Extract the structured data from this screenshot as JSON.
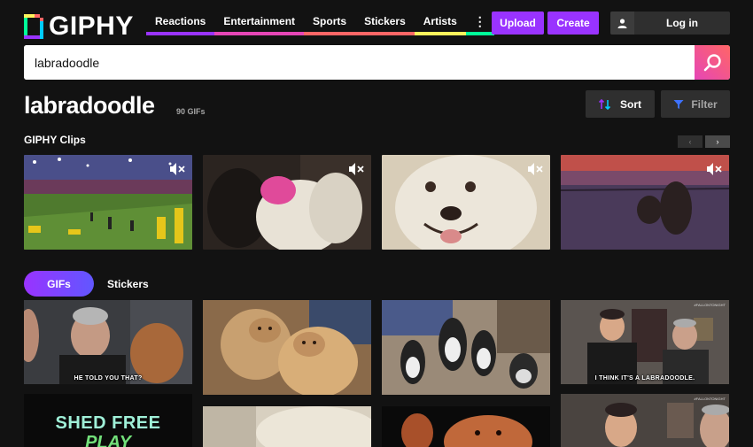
{
  "header": {
    "logo_text": "GIPHY",
    "nav": [
      {
        "label": "Reactions",
        "color": "#9933ff"
      },
      {
        "label": "Entertainment",
        "color": "#e646b6"
      },
      {
        "label": "Sports",
        "color": "#ff6666"
      },
      {
        "label": "Stickers",
        "color": "#ff6666"
      },
      {
        "label": "Artists",
        "color": "#fff35c"
      },
      {
        "label": "⋮",
        "color": "#00ff99"
      }
    ],
    "upload_label": "Upload",
    "create_label": "Create",
    "login_label": "Log in"
  },
  "search": {
    "value": "labradoodle",
    "icon": "search-icon"
  },
  "results": {
    "title": "labradoodle",
    "count": "90 GIFs",
    "sort_label": "Sort",
    "filter_label": "Filter"
  },
  "clips": {
    "section_title": "GIPHY Clips",
    "prev": "‹",
    "next": "›",
    "items": [
      {
        "icon": "mute-icon"
      },
      {
        "icon": "mute-icon"
      },
      {
        "icon": "mute-icon"
      },
      {
        "icon": "mute-icon"
      }
    ]
  },
  "tabs": {
    "gifs_label": "GIFs",
    "stickers_label": "Stickers"
  },
  "gifs": {
    "captions": [
      "HE TOLD YOU THAT?",
      "I THINK IT'S A LABRADOODLE."
    ],
    "promo_line1": "SHED FREE",
    "promo_line2": "PLAY",
    "watermark": "#FALLONTONIGHT"
  },
  "colors": {
    "accent": "#9933ff",
    "background": "#121212",
    "panel": "#2f2f2f"
  }
}
